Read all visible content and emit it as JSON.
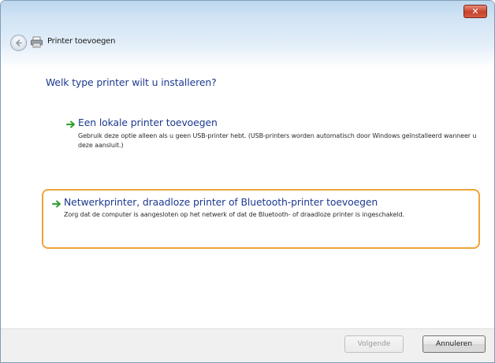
{
  "window": {
    "title": "Printer toevoegen",
    "close_label": "✕"
  },
  "main": {
    "question": "Welk type printer wilt u installeren?",
    "options": [
      {
        "title": "Een lokale printer toevoegen",
        "description": "Gebruik deze optie alleen als u geen USB-printer hebt. (USB-printers worden automatisch door Windows geïnstalleerd wanneer u deze aansluit.)"
      },
      {
        "title": "Netwerkprinter, draadloze printer of Bluetooth-printer toevoegen",
        "description": "Zorg dat de computer is aangesloten op het netwerk of dat de Bluetooth- of draadloze printer is ingeschakeld."
      }
    ]
  },
  "footer": {
    "next_label": "Volgende",
    "cancel_label": "Annuleren"
  },
  "colors": {
    "heading_blue": "#1c3a8f",
    "selection_orange": "#f0a43a",
    "arrow_green": "#2ea02e"
  }
}
